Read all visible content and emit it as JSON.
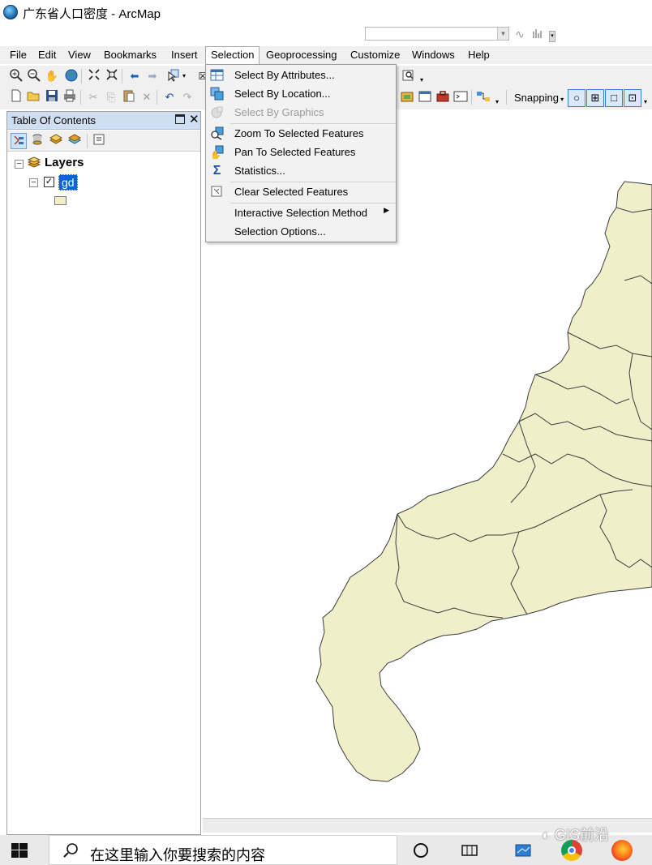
{
  "window": {
    "title": "广东省人口密度 - ArcMap"
  },
  "menubar": {
    "items": [
      "File",
      "Edit",
      "View",
      "Bookmarks",
      "Insert",
      "Selection",
      "Geoprocessing",
      "Customize",
      "Windows",
      "Help"
    ],
    "active": "Selection"
  },
  "toolbar": {
    "snapping_label": "Snapping"
  },
  "selection_menu": {
    "items": [
      {
        "label": "Select By Attributes...",
        "icon": "table-select-icon",
        "enabled": true
      },
      {
        "label": "Select By Location...",
        "icon": "location-select-icon",
        "enabled": true
      },
      {
        "label": "Select By Graphics",
        "icon": "graphics-select-icon",
        "enabled": false
      },
      {
        "label": "Zoom To Selected Features",
        "icon": "zoom-selected-icon",
        "enabled": true
      },
      {
        "label": "Pan To Selected Features",
        "icon": "pan-selected-icon",
        "enabled": true
      },
      {
        "label": "Statistics...",
        "icon": "sigma-icon",
        "enabled": true
      },
      {
        "label": "Clear Selected Features",
        "icon": "clear-selection-icon",
        "enabled": true
      },
      {
        "label": "Interactive Selection Method",
        "icon": "",
        "enabled": true,
        "submenu": true
      },
      {
        "label": "Selection Options...",
        "icon": "",
        "enabled": true
      }
    ]
  },
  "toc": {
    "title": "Table Of Contents",
    "root_label": "Layers",
    "layer_name": "gd",
    "layer_checked": true
  },
  "map": {
    "fill_color": "#f1efc9",
    "outline_color": "#3c3c3c"
  },
  "taskbar": {
    "search_placeholder": "在这里输入你要搜索的内容",
    "watermark": "GIS前沿"
  }
}
